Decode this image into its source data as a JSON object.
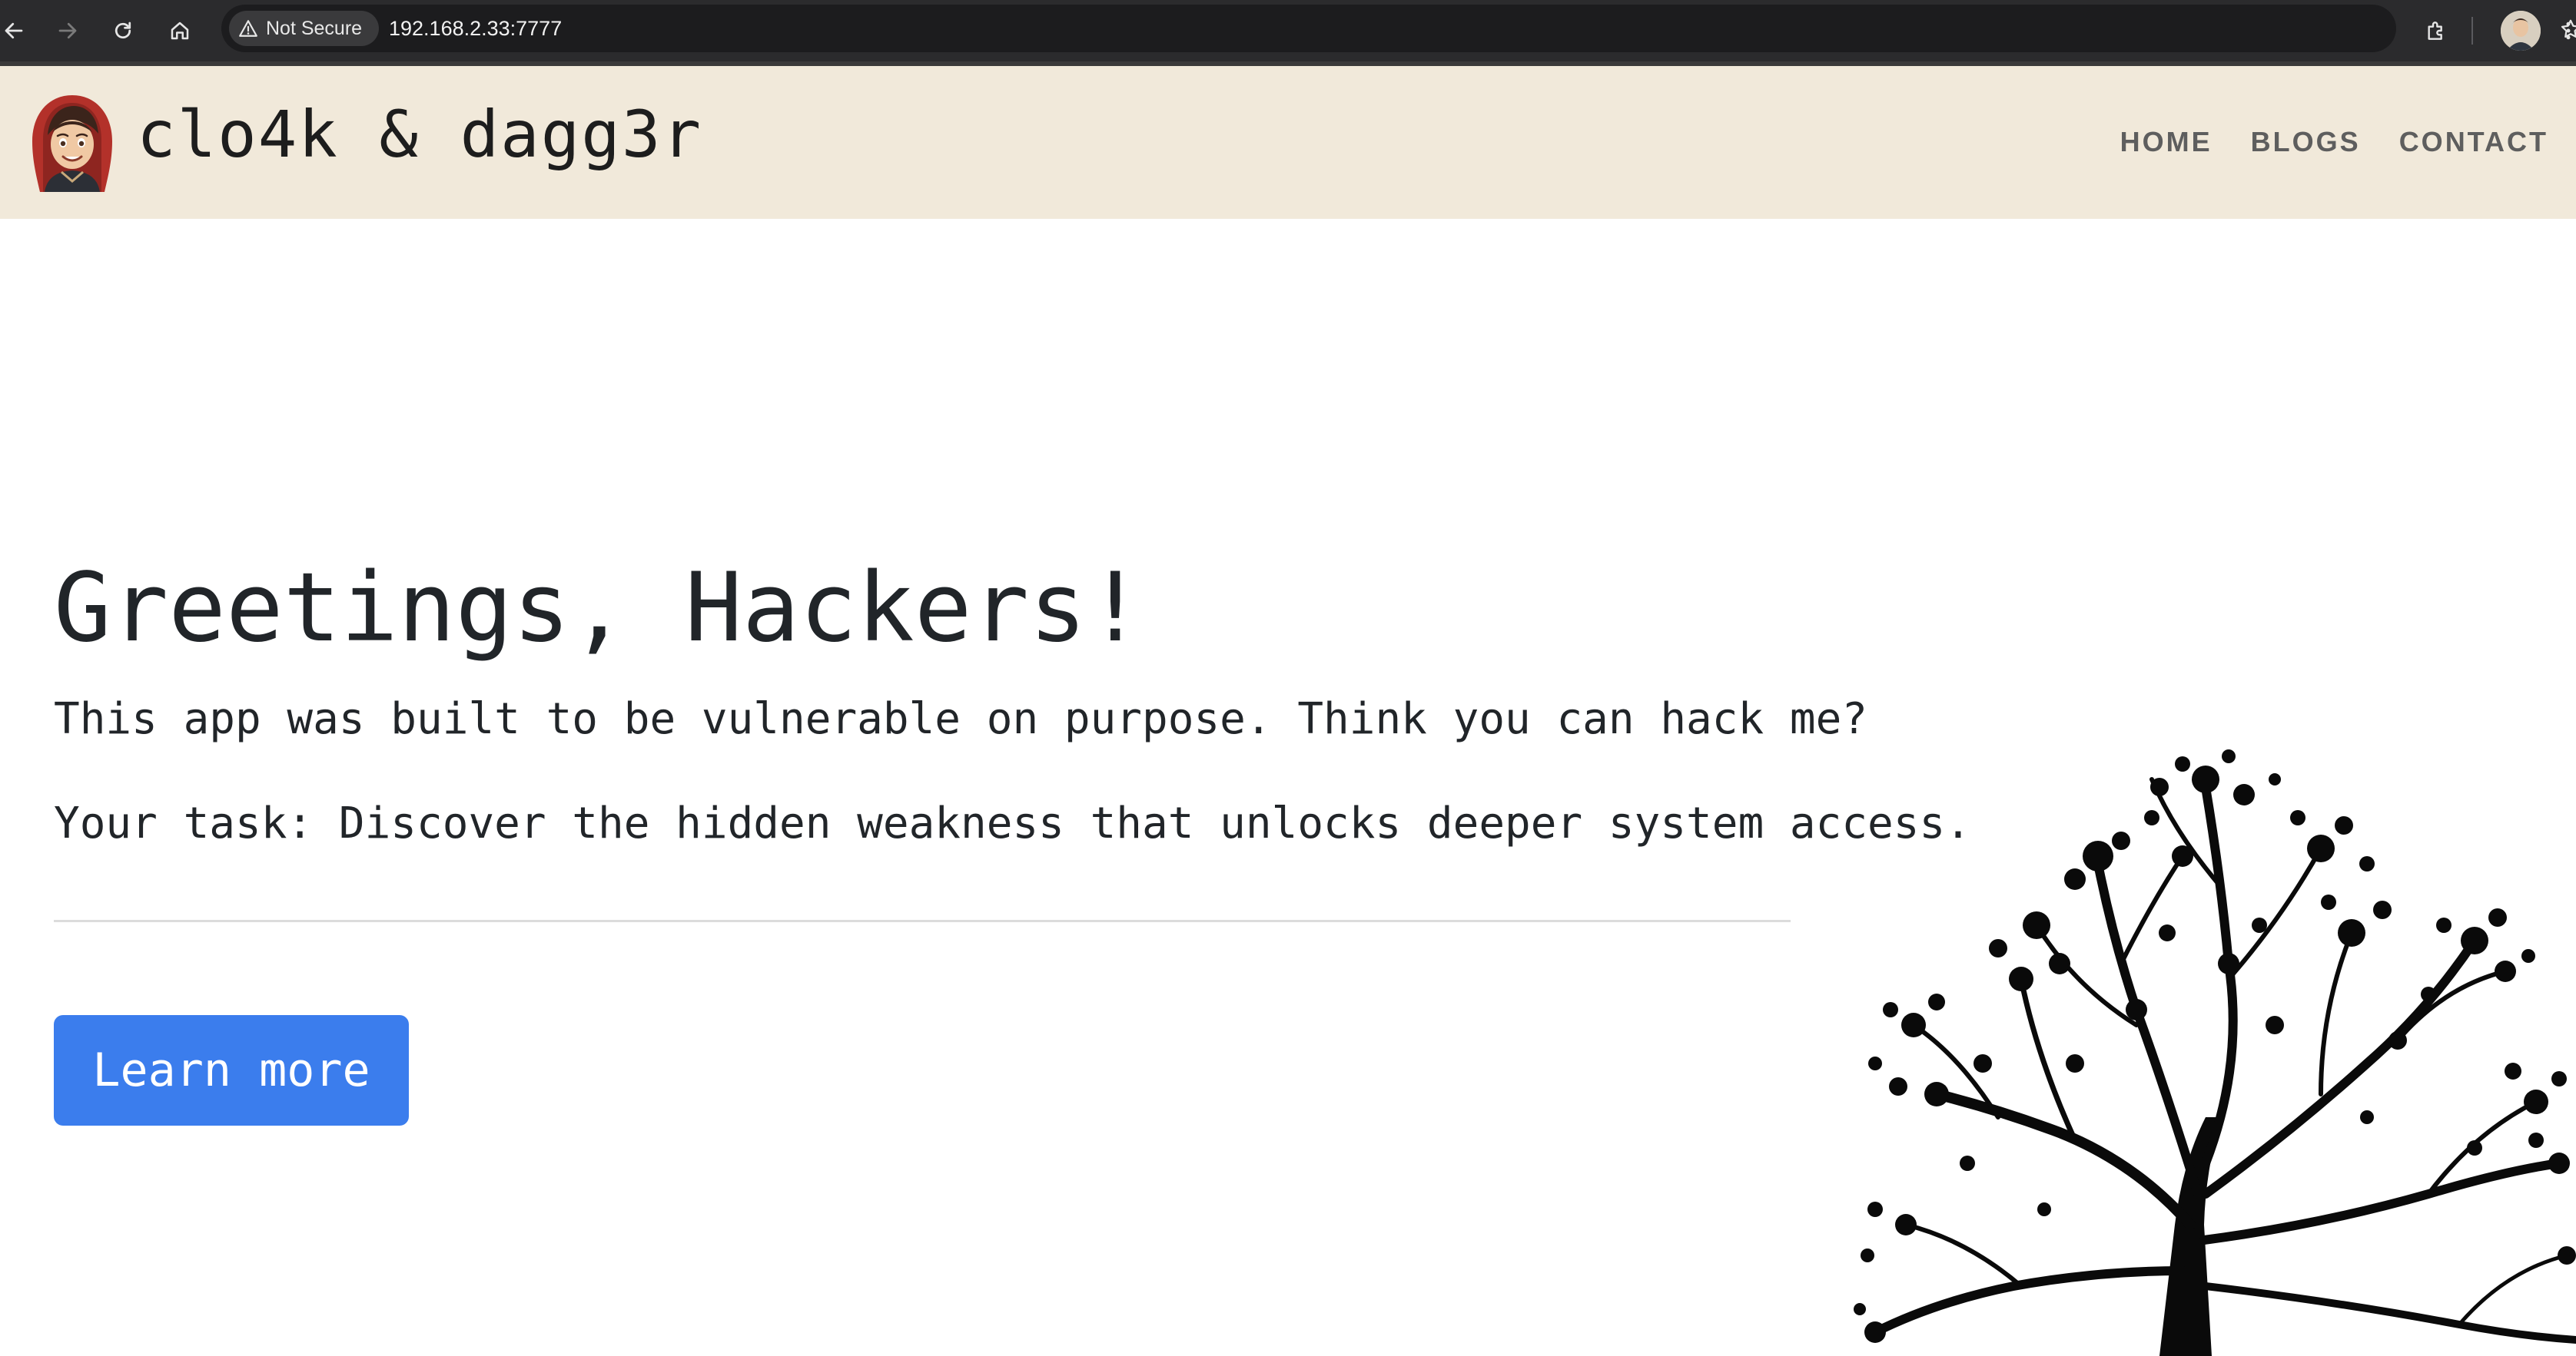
{
  "browser": {
    "security_label": "Not Secure",
    "url": "192.168.2.33:7777"
  },
  "site": {
    "title": "clo4k & dagg3r",
    "nav": [
      {
        "label": "HOME"
      },
      {
        "label": "BLOGS"
      },
      {
        "label": "CONTACT"
      }
    ]
  },
  "hero": {
    "title": "Greetings, Hackers!",
    "lead": "This app was built to be vulnerable on purpose. Think you can hack me?",
    "task": "Your task: Discover the hidden weakness that unlocks deeper system access.",
    "button_label": "Learn more"
  },
  "icons": {
    "back": "arrow-left-icon",
    "forward": "arrow-right-icon",
    "reload": "reload-icon",
    "home": "home-icon",
    "warning": "warning-triangle-icon",
    "zoom": "zoom-icon",
    "bookmark": "star-icon",
    "extensions": "puzzle-icon",
    "menu": "kebab-menu-icon"
  },
  "colors": {
    "header_bg": "#f1e9da",
    "button_bg": "#3b7ded",
    "nav_text": "#5e5e5e"
  }
}
